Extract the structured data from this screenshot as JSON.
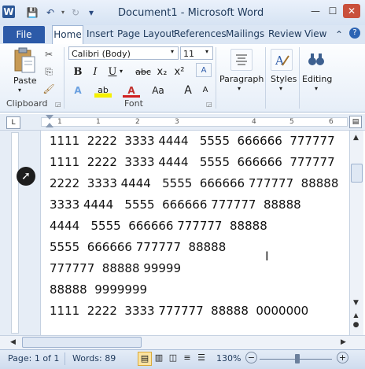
{
  "window": {
    "title": "Document1 - Microsoft Word",
    "logo": "W"
  },
  "qat": {
    "save_icon": "💾",
    "undo_icon": "↶",
    "redo_icon": "↻",
    "customize_icon": "▾"
  },
  "window_controls": {
    "minimize": "—",
    "maximize": "☐",
    "close": "✕"
  },
  "tabs": {
    "file": "File",
    "home": "Home",
    "insert": "Insert",
    "page_layout": "Page Layout",
    "references": "References",
    "mailings": "Mailings",
    "review": "Review",
    "view": "View",
    "collapse": "⌃",
    "help": "?"
  },
  "ribbon": {
    "clipboard": {
      "label": "Clipboard",
      "paste": "Paste",
      "cut_icon": "✂",
      "copy_icon": "⎘",
      "format_painter_icon": "🖌"
    },
    "font": {
      "label": "Font",
      "font_name": "Calibri (Body)",
      "font_size": "11",
      "bold": "B",
      "italic": "I",
      "underline": "U",
      "strike": "abc",
      "subscript": "x₂",
      "superscript": "x²",
      "clear_format": "A",
      "text_effects": "A",
      "highlight": "ab",
      "font_color": "A",
      "change_case": "Aa",
      "grow": "A",
      "shrink": "A"
    },
    "paragraph": {
      "label": "Paragraph"
    },
    "styles": {
      "label": "Styles"
    },
    "editing": {
      "label": "Editing"
    }
  },
  "ruler": {
    "tab_selector": "L",
    "numbers": [
      "1",
      "1",
      "2",
      "3",
      "4",
      "5",
      "6"
    ]
  },
  "document": {
    "lines": [
      "1111  2222  3333 4444   5555  666666  777777",
      "1111  2222  3333 4444   5555  666666  777777",
      "2222  3333 4444   5555  666666 777777  88888",
      "3333 4444   5555  666666 777777  88888",
      "4444   5555  666666 777777  88888",
      "5555  666666 777777  88888",
      "777777  88888 99999",
      "88888  9999999",
      "1111  2222  3333 777777  88888  0000000"
    ]
  },
  "status": {
    "page": "Page: 1 of 1",
    "words": "Words: 89",
    "zoom": "130%",
    "zoom_out": "−",
    "zoom_in": "+",
    "zoom_level_fraction": 0.49
  },
  "colors": {
    "accent": "#2c5aa8",
    "title_text": "#1e395b",
    "close": "#c9503c"
  }
}
